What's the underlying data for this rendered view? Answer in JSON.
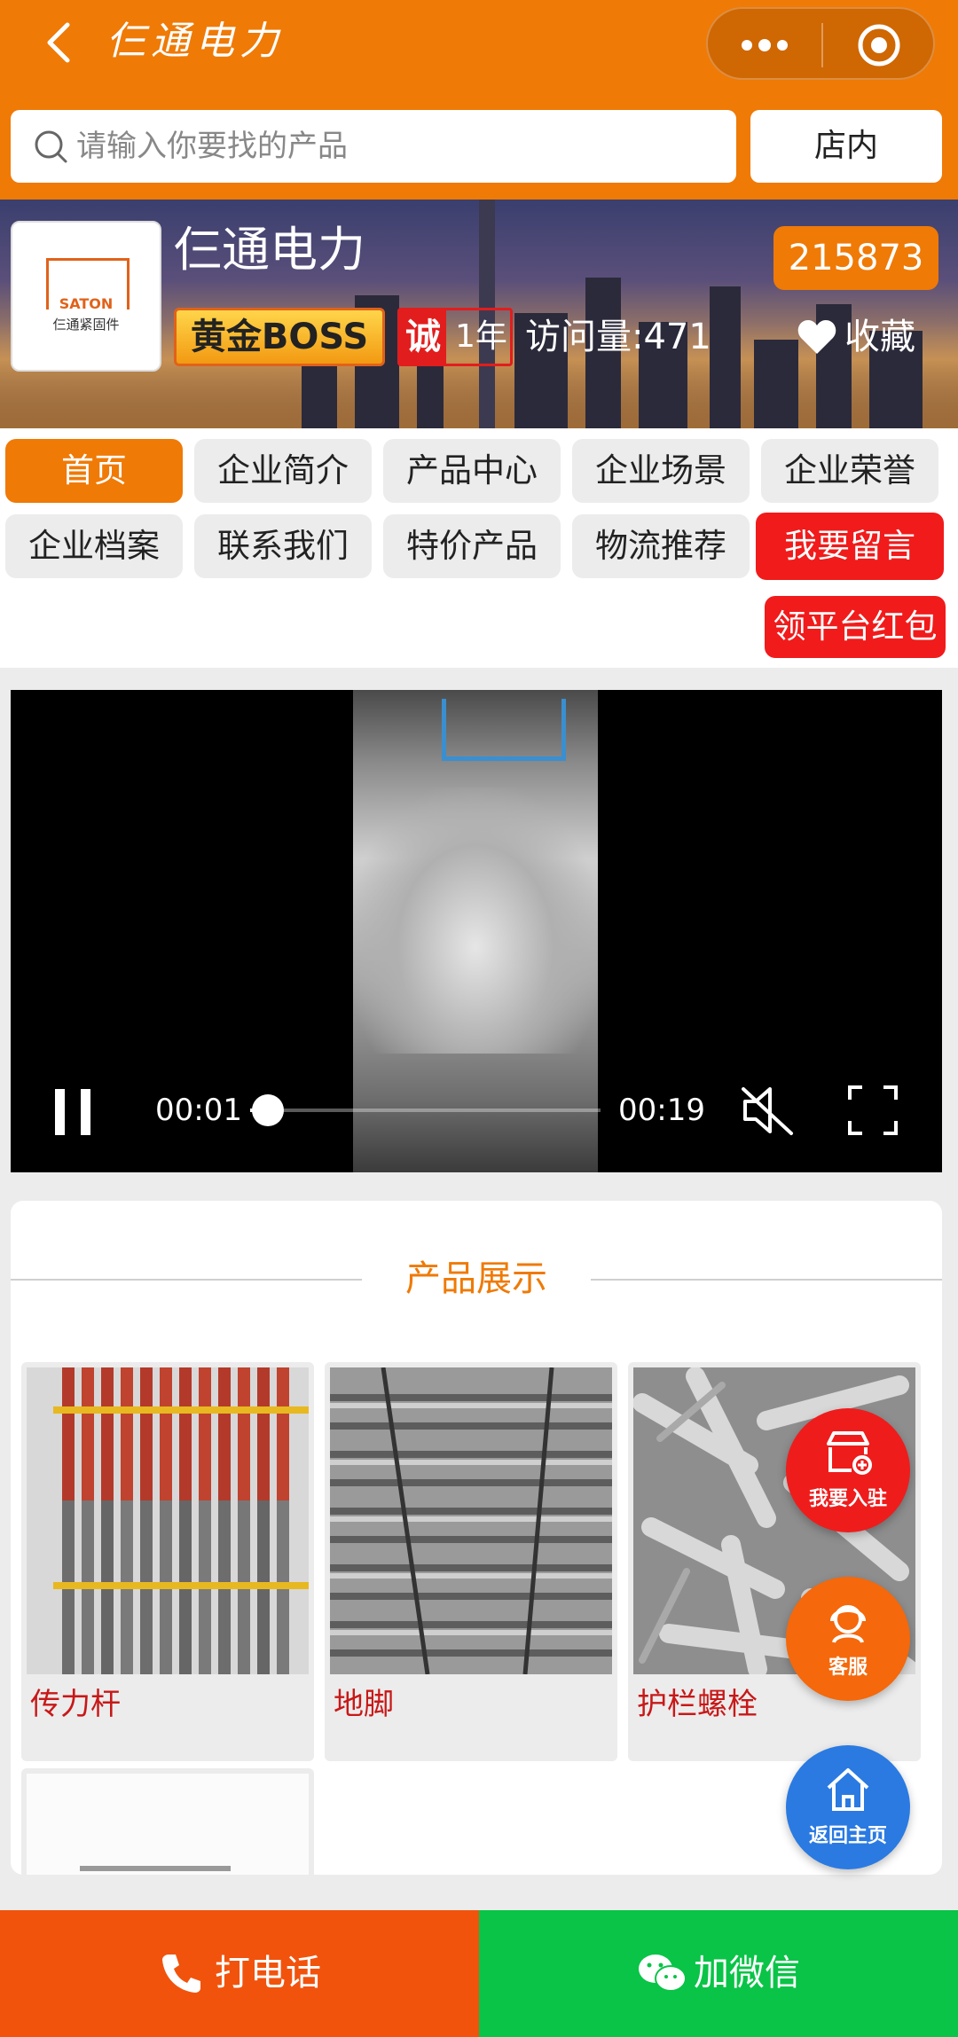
{
  "nav": {
    "title": "仨通电力"
  },
  "search": {
    "placeholder": "请输入你要找的产品",
    "store_button": "店内"
  },
  "shop": {
    "name": "仨通电力",
    "id": "215873",
    "gold_badge": "黄金BOSS",
    "cheng": "诚",
    "years": "1年",
    "visits": "访问量:471",
    "favorite": "收藏",
    "logo_en": "SATON",
    "logo_cn": "仨通紧固件"
  },
  "menu": {
    "items": [
      {
        "label": "首页"
      },
      {
        "label": "企业简介"
      },
      {
        "label": "产品中心"
      },
      {
        "label": "企业场景"
      },
      {
        "label": "企业荣誉"
      },
      {
        "label": "企业档案"
      },
      {
        "label": "联系我们"
      },
      {
        "label": "特价产品"
      },
      {
        "label": "物流推荐"
      },
      {
        "label": "我要留言"
      }
    ],
    "red_packet": "领平台红包"
  },
  "video": {
    "current_time": "00:01",
    "duration": "00:19",
    "progress": 0.05,
    "state": "playing",
    "muted": true
  },
  "products": {
    "section_title": "产品展示",
    "items": [
      {
        "name": "传力杆"
      },
      {
        "name": "地脚"
      },
      {
        "name": "护栏螺栓"
      }
    ]
  },
  "floating": {
    "join": "我要入驻",
    "service": "客服",
    "home": "返回主页"
  },
  "bottom": {
    "call": "打电话",
    "wechat": "加微信"
  },
  "colors": {
    "brand": "#ef7a06",
    "red": "#f11b1b",
    "call": "#f1530d",
    "wechat": "#09c447",
    "home_float": "#2a7ae2"
  }
}
